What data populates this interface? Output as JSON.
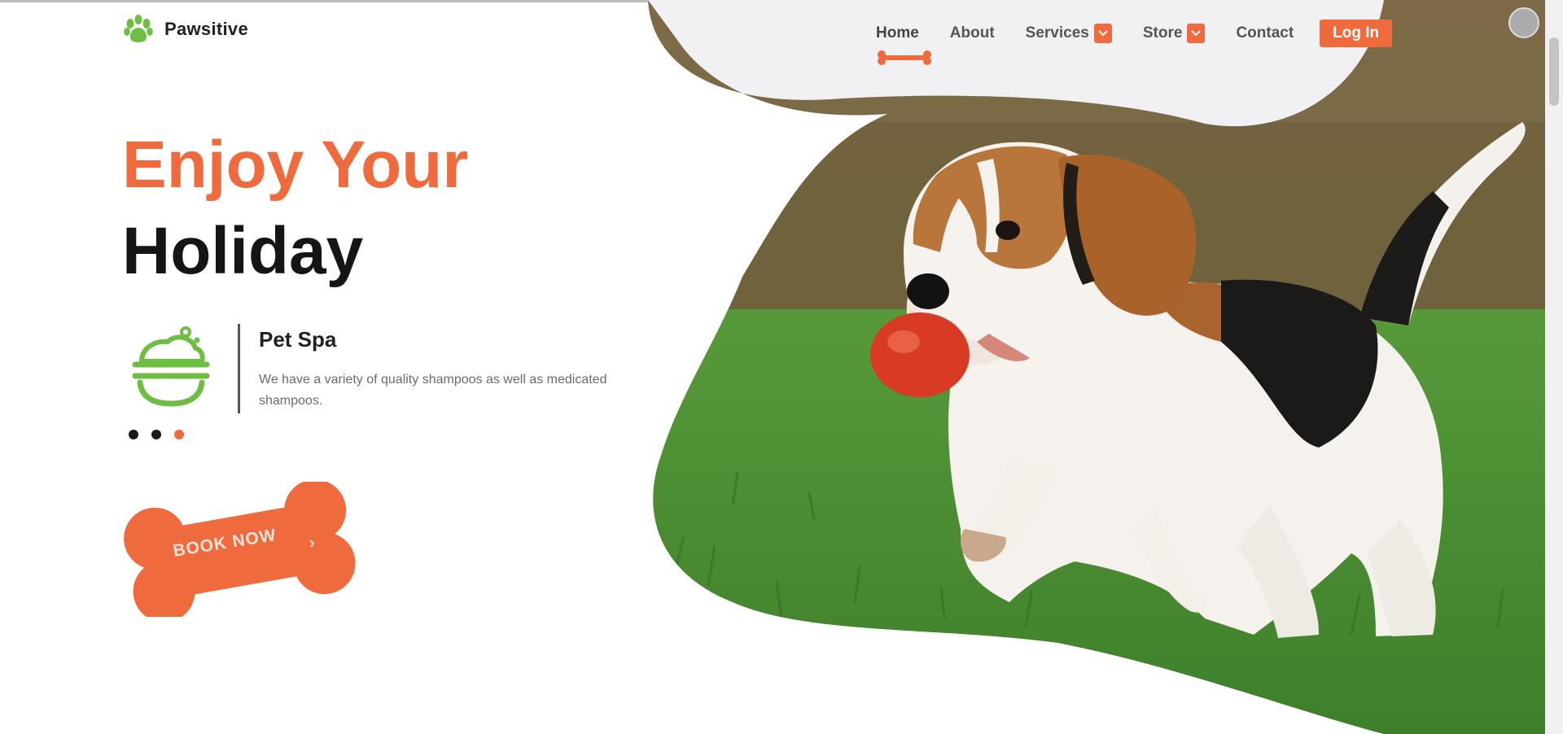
{
  "brand": {
    "name": "Pawsitive",
    "logo_icon": "paw-icon",
    "accent_color": "#ef6a3d",
    "leaf_color": "#6fbe44"
  },
  "nav": {
    "items": [
      {
        "label": "Home",
        "active": true
      },
      {
        "label": "About"
      },
      {
        "label": "Services",
        "dropdown": true
      },
      {
        "label": "Store",
        "dropdown": true
      },
      {
        "label": "Contact"
      }
    ],
    "login_label": "Log In"
  },
  "hero": {
    "title_line1": "Enjoy Your",
    "title_line2": "Holiday",
    "service": {
      "icon": "pet-bath-bowl-icon",
      "title": "Pet Spa",
      "description": "We have a variety of quality shampoos as well as medicated shampoos."
    },
    "slider_dots": {
      "count": 3,
      "active_index": 2
    },
    "cta_label": "BOOK NOW",
    "cta_arrow": "›",
    "image": "beagle-puppy-with-red-ball-on-grass"
  }
}
